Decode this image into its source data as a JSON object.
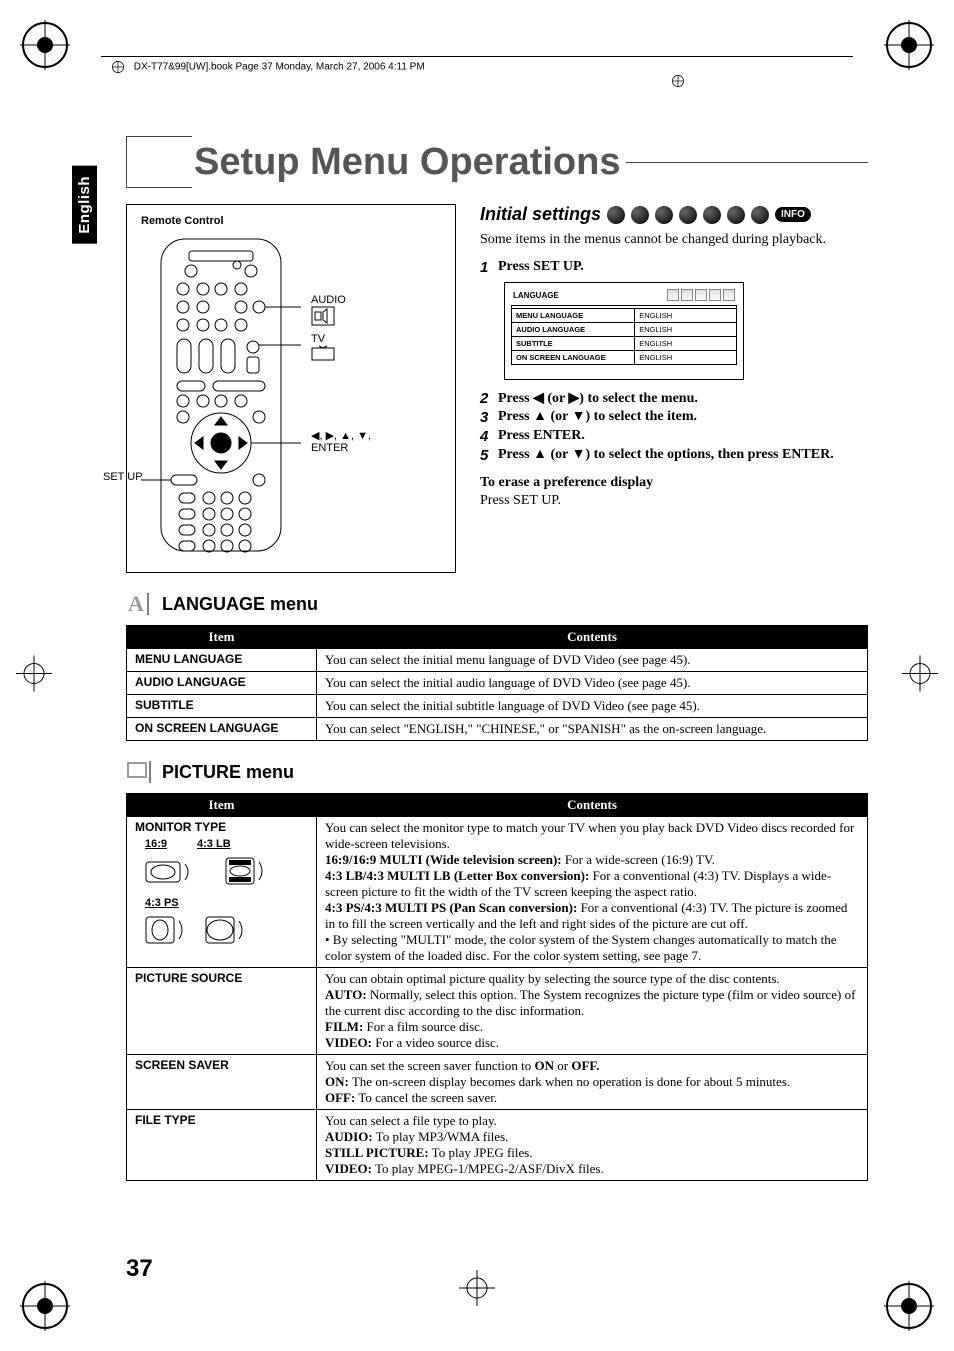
{
  "header": "DX-T77&99[UW].book  Page 37  Monday, March 27, 2006  4:11 PM",
  "lang_tab": "English",
  "title": "Setup Menu Operations",
  "remote": {
    "label": "Remote Control",
    "callout_audio": "AUDIO",
    "callout_tv": "TV",
    "callout_arrows": "◀, ▶, ▲, ▼,",
    "callout_enter": "ENTER",
    "callout_setup": "SET UP"
  },
  "right": {
    "heading": "Initial settings",
    "info_badge": "INFO",
    "intro": "Some items in the menus cannot be changed during playback.",
    "steps": [
      {
        "n": "1",
        "text": "Press SET UP."
      },
      {
        "n": "2",
        "text": "Press ◀ (or ▶) to select the menu."
      },
      {
        "n": "3",
        "text": "Press ▲ (or ▼) to select the item."
      },
      {
        "n": "4",
        "text": "Press ENTER."
      },
      {
        "n": "5",
        "text": "Press ▲ (or ▼) to select the options, then press ENTER."
      }
    ],
    "erase_head": "To erase a preference display",
    "erase_body": "Press SET UP.",
    "osd": {
      "head": "LANGUAGE",
      "rows": [
        {
          "l": "MENU LANGUAGE",
          "r": "ENGLISH"
        },
        {
          "l": "AUDIO LANGUAGE",
          "r": "ENGLISH"
        },
        {
          "l": "SUBTITLE",
          "r": "ENGLISH"
        },
        {
          "l": "ON SCREEN LANGUAGE",
          "r": "ENGLISH"
        }
      ]
    }
  },
  "lang_menu": {
    "heading": "LANGUAGE menu",
    "th_item": "Item",
    "th_contents": "Contents",
    "rows": [
      {
        "item": "MENU LANGUAGE",
        "contents": "You can select the initial menu language of DVD Video (see page 45)."
      },
      {
        "item": "AUDIO LANGUAGE",
        "contents": "You can select the initial audio language of DVD Video (see page 45)."
      },
      {
        "item": "SUBTITLE",
        "contents": "You can select the initial subtitle language of DVD Video (see page 45)."
      },
      {
        "item": "ON SCREEN LANGUAGE",
        "contents": "You can select \"ENGLISH,\" \"CHINESE,\" or \"SPANISH\" as the on-screen language."
      }
    ]
  },
  "picture_menu": {
    "heading": "PICTURE menu",
    "th_item": "Item",
    "th_contents": "Contents",
    "monitor": {
      "item": "MONITOR TYPE",
      "l1": "16:9",
      "l2": "4:3 LB",
      "l3": "4:3 PS",
      "contents_pre": "You can select the monitor type to match your TV when you play back DVD Video discs recorded for wide-screen televisions.",
      "opt1_b": "16:9/16:9 MULTI (Wide television screen):",
      "opt1_t": " For a wide-screen (16:9) TV.",
      "opt2_b": "4:3 LB/4:3 MULTI LB (Letter Box conversion):",
      "opt2_t": " For a conventional (4:3) TV. Displays a wide-screen picture to fit the width of the TV screen keeping the aspect ratio.",
      "opt3_b": "4:3 PS/4:3 MULTI PS (Pan Scan conversion):",
      "opt3_t": " For a conventional (4:3) TV. The picture is zoomed in to fill the screen vertically and the left and right sides of the picture are cut off.",
      "opt4": "• By selecting \"MULTI\" mode, the color system of the System changes automatically to match the color system of the loaded disc. For the color system setting, see page 7."
    },
    "source": {
      "item": "PICTURE SOURCE",
      "l1": "You can obtain optimal picture quality by selecting the source type of the disc contents.",
      "l2b": "AUTO:",
      "l2t": " Normally, select this option. The System recognizes the picture type (film or video source) of the current disc according to the disc information.",
      "l3b": "FILM:",
      "l3t": " For a film source disc.",
      "l4b": "VIDEO:",
      "l4t": " For a video source disc."
    },
    "saver": {
      "item": "SCREEN SAVER",
      "l1": "You can set the screen saver function to ",
      "l1b1": "ON",
      "l1m": " or ",
      "l1b2": "OFF.",
      "l2b": "ON:",
      "l2t": " The on-screen display becomes dark when no operation is done for about 5 minutes.",
      "l3b": "OFF:",
      "l3t": " To cancel the screen saver."
    },
    "file": {
      "item": "FILE TYPE",
      "l1": "You can select a file type to play.",
      "l2b": "AUDIO:",
      "l2t": " To play MP3/WMA files.",
      "l3b": "STILL PICTURE:",
      "l3t": " To play JPEG files.",
      "l4b": "VIDEO:",
      "l4t": " To play MPEG-1/MPEG-2/ASF/DivX files."
    }
  },
  "page_num": "37"
}
